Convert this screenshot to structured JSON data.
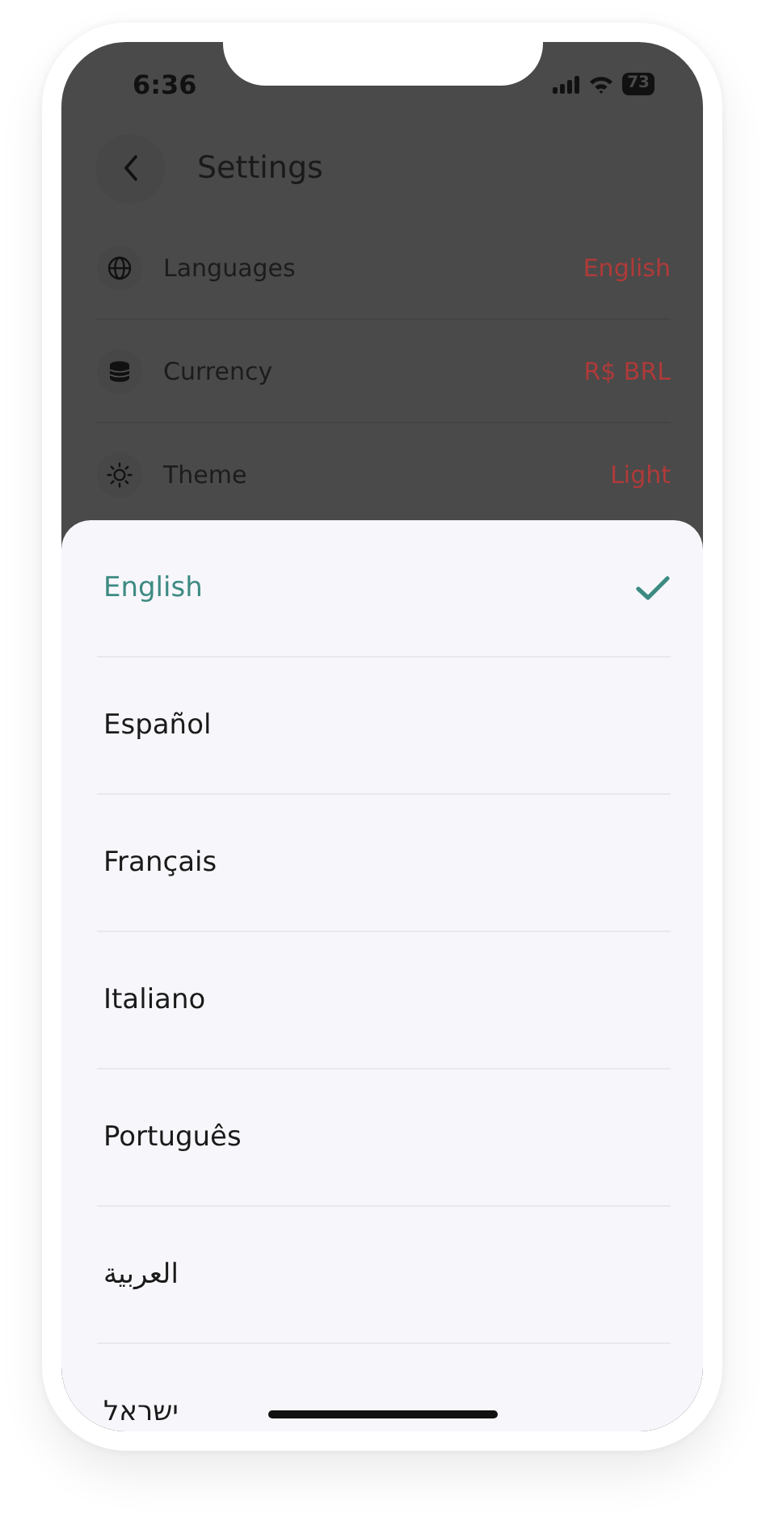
{
  "status_bar": {
    "time": "6:36",
    "battery": "73"
  },
  "header": {
    "title": "Settings"
  },
  "settings": [
    {
      "kind": "language",
      "label": "Languages",
      "value": "English"
    },
    {
      "kind": "currency",
      "label": "Currency",
      "value": "R$ BRL"
    },
    {
      "kind": "theme",
      "label": "Theme",
      "value": "Light"
    }
  ],
  "language_sheet": {
    "options": [
      {
        "label": "English",
        "selected": true
      },
      {
        "label": "Español",
        "selected": false
      },
      {
        "label": "Français",
        "selected": false
      },
      {
        "label": "Italiano",
        "selected": false
      },
      {
        "label": "Português",
        "selected": false
      },
      {
        "label": "العربية",
        "selected": false
      },
      {
        "label": "ישראל",
        "selected": false
      }
    ]
  }
}
